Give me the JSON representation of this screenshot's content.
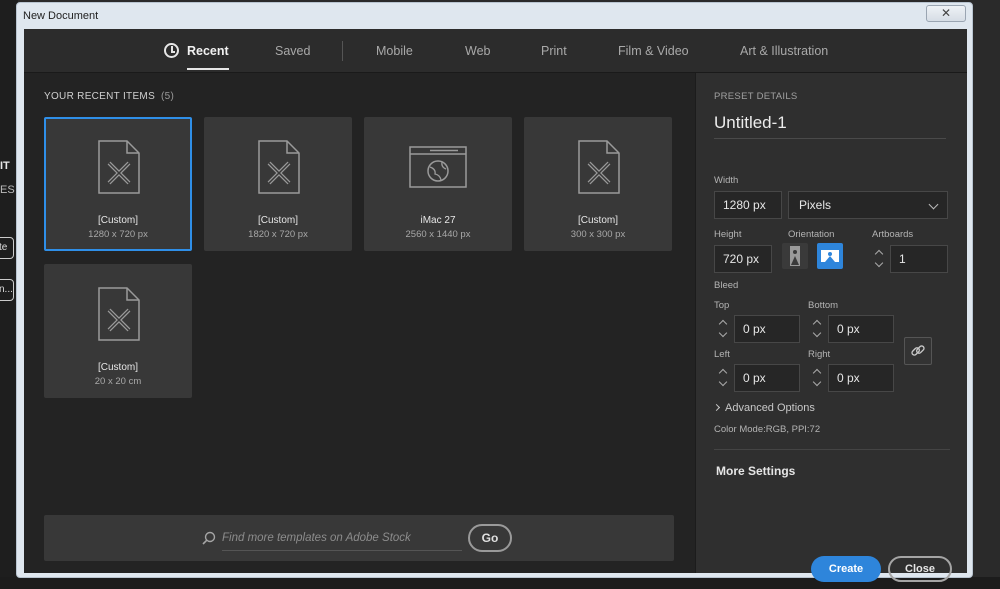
{
  "background": {
    "fragment_1": "IT",
    "fragment_2": "ES",
    "fragment_btn_1": "te n",
    "fragment_btn_2": "n..."
  },
  "window": {
    "title": "New Document",
    "close_label": "✕"
  },
  "tabs": [
    {
      "label": "Recent",
      "active": true
    },
    {
      "label": "Saved",
      "active": false
    },
    {
      "label": "Mobile",
      "active": false
    },
    {
      "label": "Web",
      "active": false
    },
    {
      "label": "Print",
      "active": false
    },
    {
      "label": "Film & Video",
      "active": false
    },
    {
      "label": "Art & Illustration",
      "active": false
    }
  ],
  "recent": {
    "heading": "YOUR RECENT ITEMS",
    "count": "(5)",
    "items": [
      {
        "name": "[Custom]",
        "dims": "1280 x 720 px",
        "icon": "document-pencil-icon"
      },
      {
        "name": "[Custom]",
        "dims": "1820 x 720 px",
        "icon": "document-pencil-icon"
      },
      {
        "name": "iMac 27",
        "dims": "2560 x 1440 px",
        "icon": "browser-globe-icon"
      },
      {
        "name": "[Custom]",
        "dims": "300 x 300 px",
        "icon": "document-pencil-icon"
      },
      {
        "name": "[Custom]",
        "dims": "20 x 20 cm",
        "icon": "document-pencil-icon"
      }
    ]
  },
  "stock": {
    "placeholder": "Find more templates on Adobe Stock",
    "go_label": "Go"
  },
  "preset": {
    "heading": "PRESET DETAILS",
    "doc_name": "Untitled-1",
    "width_label": "Width",
    "width_value": "1280 px",
    "unit": "Pixels",
    "height_label": "Height",
    "height_value": "720 px",
    "orientation_label": "Orientation",
    "artboards_label": "Artboards",
    "artboards_value": "1",
    "bleed_label": "Bleed",
    "top_label": "Top",
    "top_value": "0 px",
    "bottom_label": "Bottom",
    "bottom_value": "0 px",
    "left_label": "Left",
    "left_value": "0 px",
    "right_label": "Right",
    "right_value": "0 px",
    "advanced_label": "Advanced Options",
    "color_mode": "Color Mode:RGB, PPI:72",
    "more_settings": "More Settings",
    "create_label": "Create",
    "close_label": "Close"
  },
  "colors": {
    "accent": "#2e85db",
    "panel": "#2f2f2f",
    "tile": "#383838"
  }
}
